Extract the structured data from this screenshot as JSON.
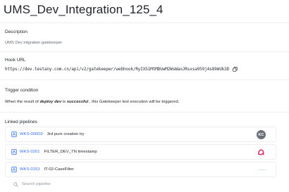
{
  "page": {
    "title": "UMS_Dev_Integration_125_4"
  },
  "description": {
    "label": "Description",
    "value": "UMS Dev intgration gatekeeper"
  },
  "hook": {
    "label": "Hook URL",
    "url": "https://dev.testany.com.cn/api/v2/gatekeeper/webhook/RyIXS1MtMDUwM2WsWaoJRsxsa959j4s89mUk3D",
    "copy_icon": "copy-icon"
  },
  "trigger": {
    "label": "Trigger condition",
    "prefix": "When the result of ",
    "pipeline_ref": "deploy dev",
    "middle": " is ",
    "result": "successful",
    "suffix": " , this Gatekeeper test execution will be triggered."
  },
  "linked": {
    "label": "Linked pipelines",
    "items": [
      {
        "id": "WKS-000D9",
        "name": "3rd pure creation try",
        "avatar": "KC",
        "icon": "pipeline-icon"
      },
      {
        "id": "WKS-0201",
        "name": "FILTER_DEV_TN timestamp",
        "avatar": "a",
        "icon": "pipeline-icon"
      },
      {
        "id": "WKS-0153",
        "name": "IT-02-CaseFilter",
        "avatar": "",
        "icon": "pipeline-icon"
      }
    ],
    "search_placeholder": "Search pipeline",
    "search_icon": "search-icon"
  },
  "colors": {
    "link": "#3370ff",
    "text": "#1f2329",
    "muted": "#646a73",
    "avatar_kc": "#6b7079",
    "avatar_a": "#e0245e"
  }
}
